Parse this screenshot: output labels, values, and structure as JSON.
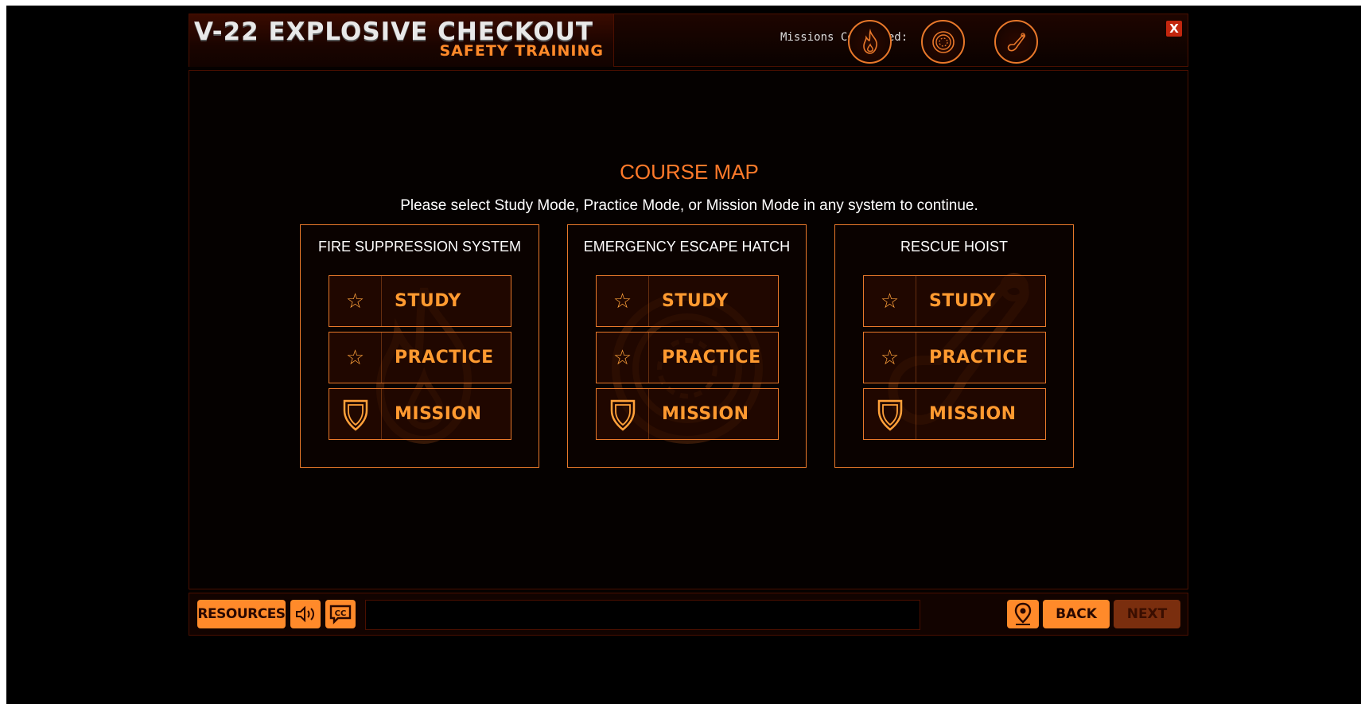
{
  "header": {
    "title": "V-22 EXPLOSIVE CHECKOUT",
    "subtitle": "SAFETY TRAINING",
    "missions_label": "Missions Completed:",
    "mission_badges": [
      "fire-badge-icon",
      "hatch-badge-icon",
      "hoist-badge-icon"
    ],
    "close_label": "X"
  },
  "main": {
    "title": "COURSE MAP",
    "instruction": "Please select Study Mode, Practice Mode, or Mission Mode in any system to continue.",
    "systems": [
      {
        "title": "FIRE SUPPRESSION SYSTEM",
        "background_icon": "flame-icon",
        "modes": [
          {
            "label": "STUDY",
            "icon": "star-icon"
          },
          {
            "label": "PRACTICE",
            "icon": "star-icon"
          },
          {
            "label": "MISSION",
            "icon": "shield-icon"
          }
        ]
      },
      {
        "title": "EMERGENCY ESCAPE HATCH",
        "background_icon": "hatch-icon",
        "modes": [
          {
            "label": "STUDY",
            "icon": "star-icon"
          },
          {
            "label": "PRACTICE",
            "icon": "star-icon"
          },
          {
            "label": "MISSION",
            "icon": "shield-icon"
          }
        ]
      },
      {
        "title": "RESCUE HOIST",
        "background_icon": "hook-icon",
        "modes": [
          {
            "label": "STUDY",
            "icon": "star-icon"
          },
          {
            "label": "PRACTICE",
            "icon": "star-icon"
          },
          {
            "label": "MISSION",
            "icon": "shield-icon"
          }
        ]
      }
    ]
  },
  "footer": {
    "resources_label": "RESOURCES",
    "audio_icon": "speaker-icon",
    "cc_label": "CC",
    "caption_text": "",
    "map_icon": "map-pin-icon",
    "back_label": "BACK",
    "next_label": "NEXT"
  },
  "colors": {
    "accent": "#ff8a2a",
    "title_orange": "#ff7a2a",
    "border": "#e8782a",
    "close": "#c2260e",
    "next_disabled": "#7a2e0e",
    "background": "#050100"
  }
}
